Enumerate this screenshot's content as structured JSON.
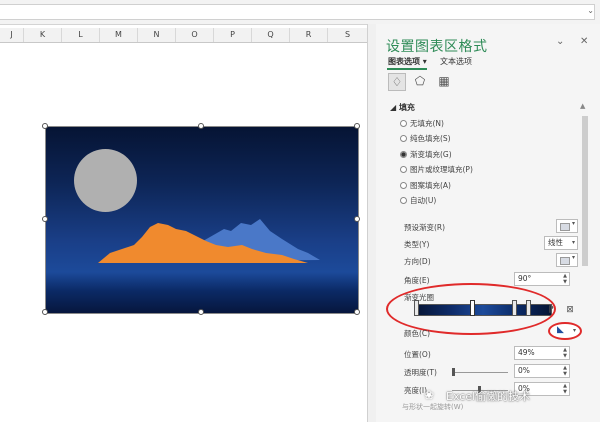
{
  "columns": [
    "J",
    "K",
    "L",
    "M",
    "N",
    "O",
    "P",
    "Q",
    "R",
    "S"
  ],
  "pane": {
    "title": "设置图表区格式",
    "tabs": [
      "图表选项 ▾",
      "文本选项"
    ],
    "section": "◢ 填充",
    "fill_options": [
      {
        "label": "无填充(N)",
        "checked": false
      },
      {
        "label": "纯色填充(S)",
        "checked": false
      },
      {
        "label": "渐变填充(G)",
        "checked": true
      },
      {
        "label": "图片或纹理填充(P)",
        "checked": false
      },
      {
        "label": "图案填充(A)",
        "checked": false
      },
      {
        "label": "自动(U)",
        "checked": false
      }
    ],
    "preset_label": "预设渐变(R)",
    "type_label": "类型(Y)",
    "type_value": "线性",
    "direction_label": "方向(D)",
    "angle_label": "角度(E)",
    "angle_value": "90°",
    "stops_label": "渐变光圈",
    "color_label": "颜色(C)",
    "position_label": "位置(O)",
    "position_value": "49%",
    "transparency_label": "透明度(T)",
    "transparency_value": "0%",
    "brightness_label": "亮度(I)",
    "brightness_value": "0%",
    "faded_row": "与形状一起旋转(W)"
  },
  "watermark": "Excel偷懒的技术",
  "colors": {
    "accent": "#2e8b57",
    "moon": "#b0b0b0",
    "mountain_front": "#f08a2e",
    "mountain_back": "#4a78c8",
    "highlight": "#e02a2a"
  }
}
